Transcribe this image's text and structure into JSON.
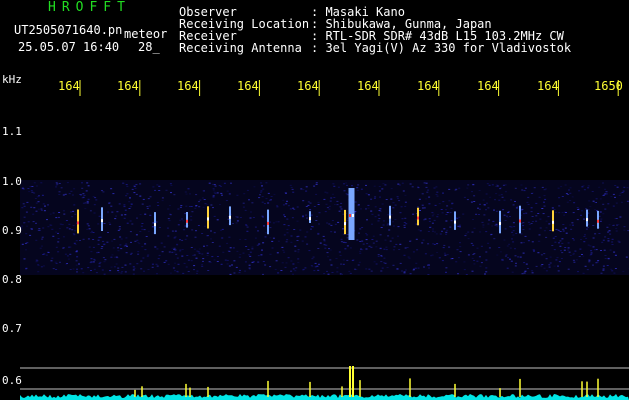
{
  "header": {
    "logo": "HROFFT",
    "filename": "UT2505071640.pn",
    "datetime": "25.05.07 16:40",
    "count": "28_",
    "tag": "meteor"
  },
  "info": [
    {
      "label": "Observer",
      "value": ": Masaki Kano"
    },
    {
      "label": "Receiving Location",
      "value": ": Shibukawa, Gunma, Japan"
    },
    {
      "label": "Receiver",
      "value": ": RTL-SDR SDR# 43dB L15 103.2MHz CW"
    },
    {
      "label": "Receiving Antenna",
      "value": ": 3el Yagi(V) Az 330 for Vladivostok"
    }
  ],
  "axis": {
    "unit": "kHz",
    "y_ticks": [
      "1.1",
      "1.0",
      "0.9",
      "0.8",
      "0.7",
      "0.6"
    ],
    "x_ticks": [
      "164",
      "164",
      "164",
      "164",
      "164",
      "164",
      "164",
      "164",
      "164",
      "1650"
    ]
  },
  "colors": {
    "text": "#ffffff",
    "logo": "#22dd22",
    "time_labels": "#ffff33",
    "noise_band": "#1a1a8c",
    "baseline": "#00e5e5",
    "spike": "#ffff33"
  }
}
